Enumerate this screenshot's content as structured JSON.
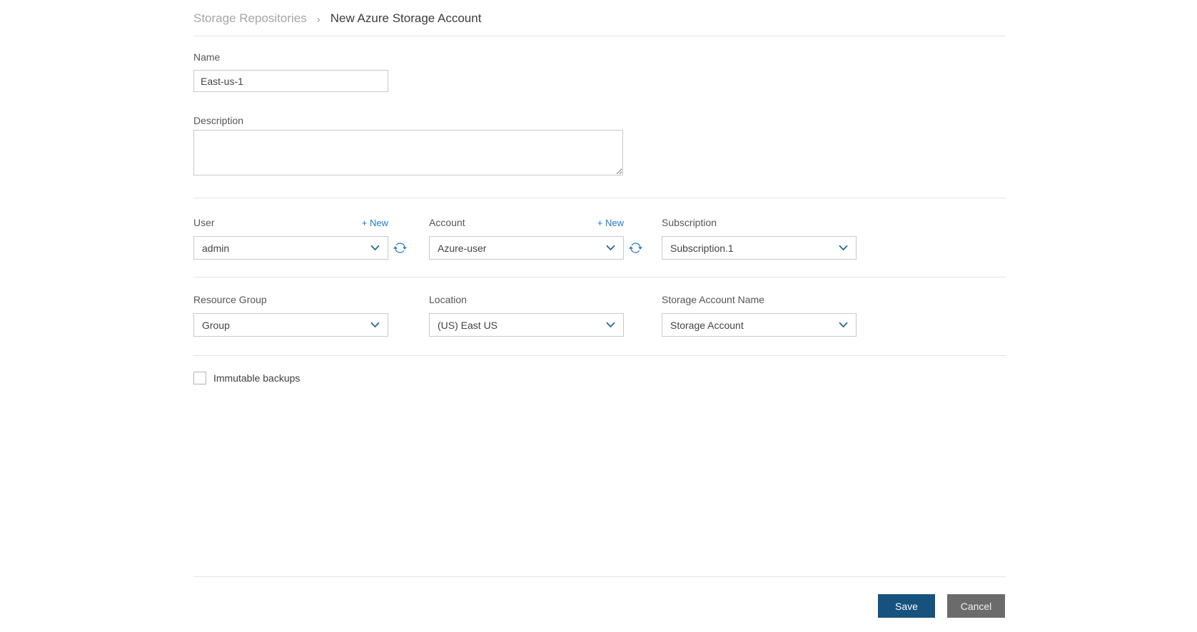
{
  "page": {
    "title": "New Azure Storage Account"
  },
  "breadcrumb": {
    "parent": "Storage Repositories",
    "separator": "›",
    "current": "New Azure Storage Account"
  },
  "form": {
    "name": {
      "label": "Name",
      "value": "East-us-1"
    },
    "description": {
      "label": "Description",
      "value": ""
    },
    "user": {
      "label": "User",
      "new_link": "+ New",
      "value": "admin"
    },
    "account": {
      "label": "Account",
      "new_link": "+ New",
      "value": "Azure-user"
    },
    "subscription": {
      "label": "Subscription",
      "value": "Subscription.1"
    },
    "resource_group": {
      "label": "Resource Group",
      "value": "Group"
    },
    "location": {
      "label": "Location",
      "value": "(US) East US"
    },
    "storage_account_name": {
      "label": "Storage Account Name",
      "value": "Storage Account"
    },
    "immutable_backups": {
      "label": "Immutable backups",
      "checked": false
    }
  },
  "actions": {
    "save_label": "Save",
    "cancel_label": "Cancel"
  },
  "icons": {
    "chevron_down": "chevron-down-icon",
    "refresh": "refresh-icon",
    "checkbox": "checkbox-unchecked"
  },
  "colors": {
    "link_blue": "#1e7bc8",
    "icon_blue": "#1c7cc5",
    "chevron_blue": "#24649c",
    "save_bg": "#17517e",
    "cancel_bg": "#6b6b6b",
    "divider": "#e4e4e4",
    "input_border": "#c9c9c9",
    "label_text": "#565656",
    "value_text": "#444444",
    "breadcrumb_inactive": "#a6a6a6",
    "breadcrumb_active": "#3c3c3c"
  }
}
